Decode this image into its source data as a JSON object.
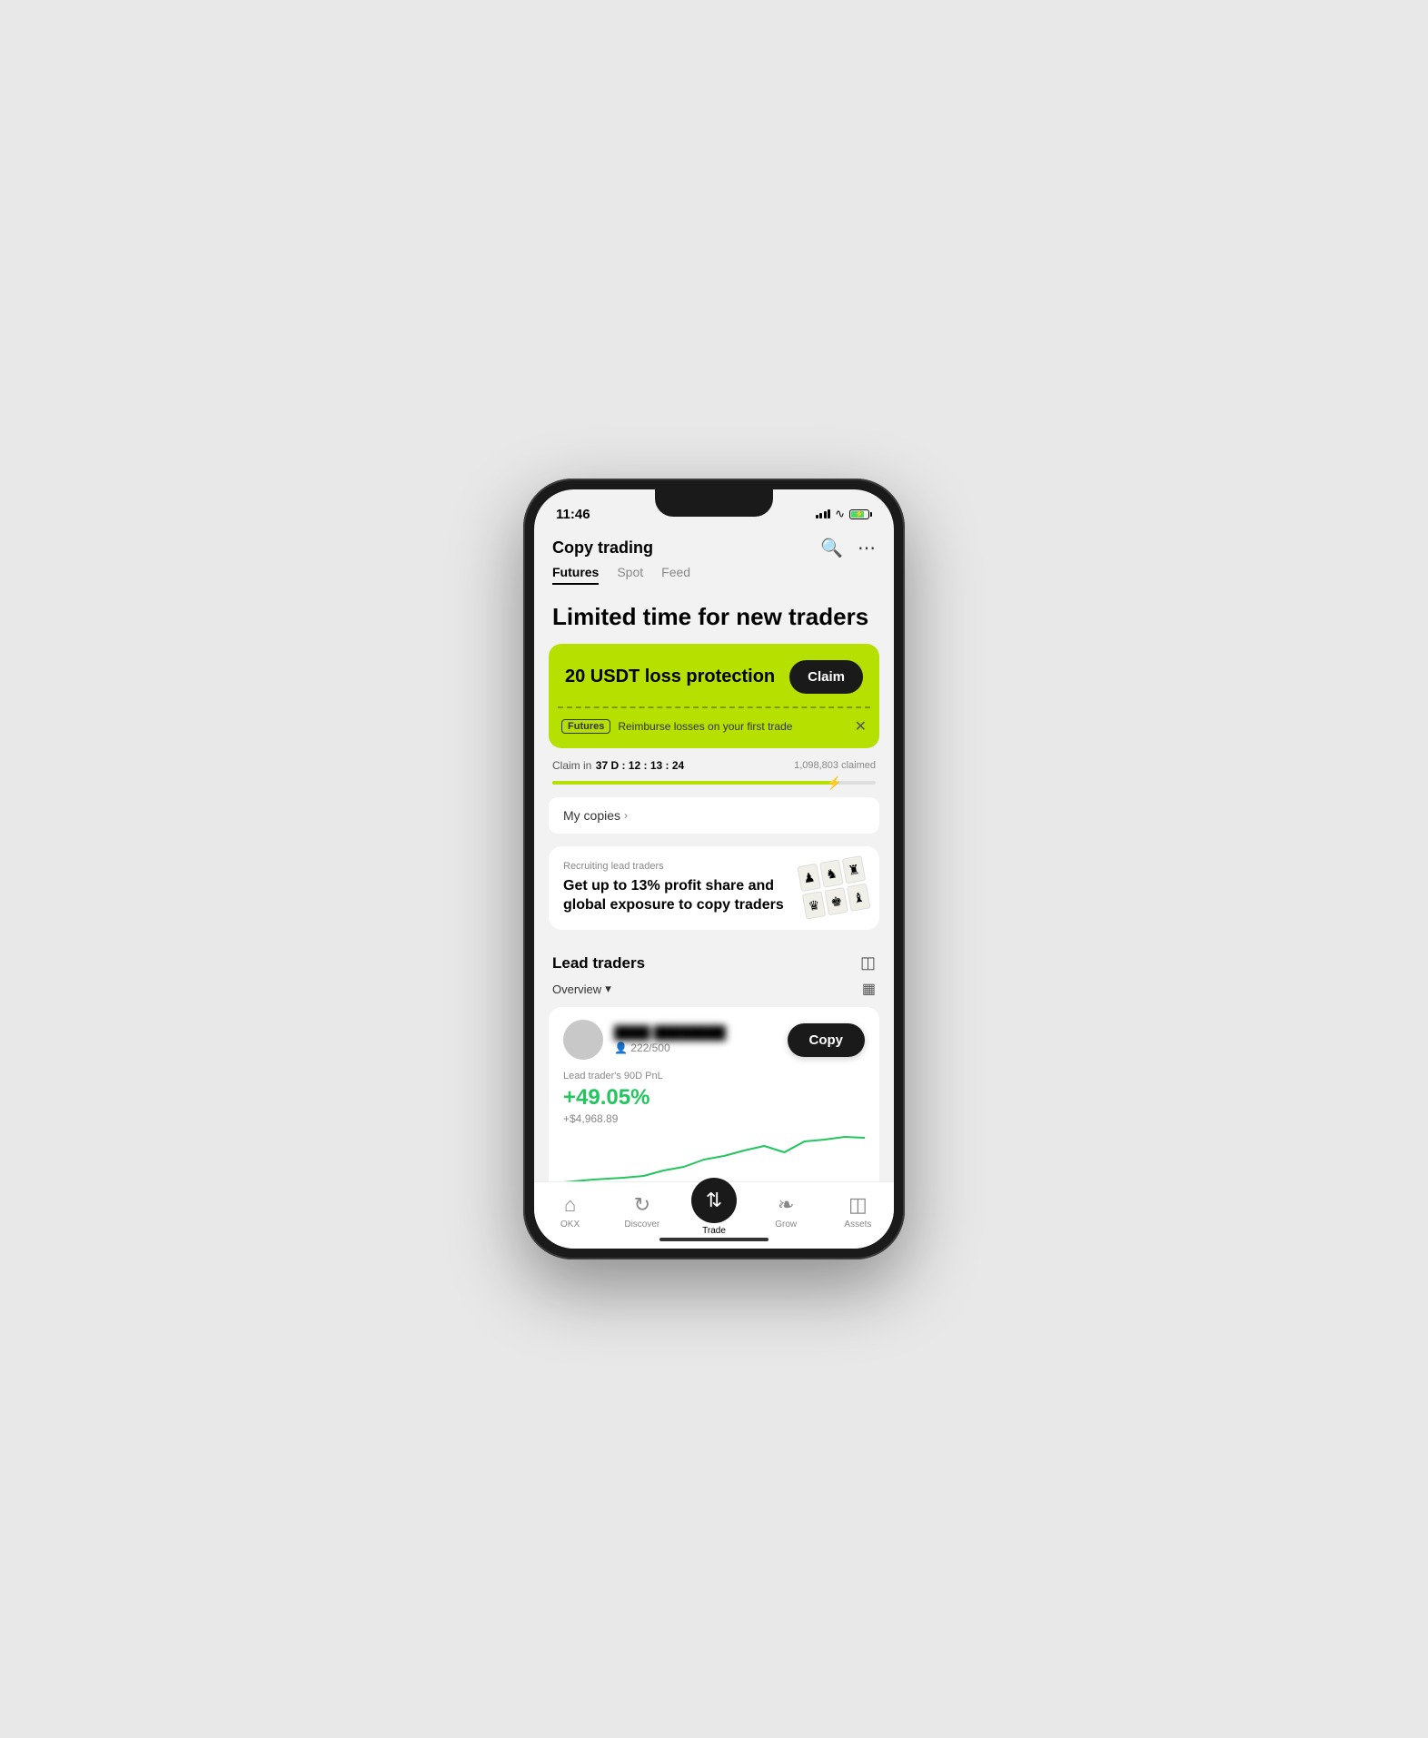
{
  "status_bar": {
    "time": "11:46"
  },
  "header": {
    "title": "Copy trading",
    "search_label": "search",
    "more_label": "more"
  },
  "tabs": [
    {
      "label": "Futures",
      "active": true
    },
    {
      "label": "Spot",
      "active": false
    },
    {
      "label": "Feed",
      "active": false
    }
  ],
  "hero": {
    "text": "Limited time for new traders"
  },
  "promo": {
    "main_text": "20 USDT loss protection",
    "claim_label": "Claim",
    "futures_badge": "Futures",
    "subtitle": "Reimburse losses on your first trade",
    "claim_in_label": "Claim in",
    "timer": "37 D : 12 : 13 : 24",
    "claimed_count": "1,098,803 claimed",
    "progress_pct": 88
  },
  "my_copies": {
    "label": "My copies",
    "arrow": "›"
  },
  "recruiting": {
    "label": "Recruiting lead traders",
    "text": "Get up to 13% profit share and global exposure to copy traders"
  },
  "lead_traders": {
    "section_title": "Lead traders",
    "overview_label": "Overview",
    "trader": {
      "name": "████ ████████",
      "followers": "222/500",
      "pnl_label": "Lead trader's 90D PnL",
      "pnl_value": "+49.05%",
      "pnl_usd": "+$4,968.89",
      "copy_label": "Copy"
    }
  },
  "bottom_nav": [
    {
      "label": "OKX",
      "icon": "⌂",
      "active": false
    },
    {
      "label": "Discover",
      "icon": "↻",
      "active": false
    },
    {
      "label": "Trade",
      "icon": "⇅",
      "active": true,
      "is_center": true
    },
    {
      "label": "Grow",
      "icon": "⚘",
      "active": false
    },
    {
      "label": "Assets",
      "icon": "▣",
      "active": false
    }
  ],
  "colors": {
    "accent": "#b5e000",
    "dark": "#1a1a1a",
    "green": "#22c55e"
  }
}
